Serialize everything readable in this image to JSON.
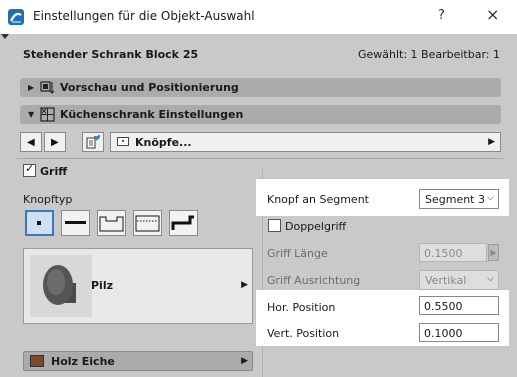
{
  "window": {
    "title": "Einstellungen für die Objekt-Auswahl",
    "help": "?",
    "close": "×"
  },
  "header": {
    "object_name": "Stehender Schrank Block 25",
    "selection_info": "Gewählt: 1 Bearbeitbar: 1"
  },
  "sections": {
    "preview": "Vorschau und Positionierung",
    "kitchen": "Küchenschrank Einstellungen"
  },
  "nav": {
    "prev": "◀",
    "next": "▶",
    "page": "Knöpfe...",
    "page_arrow": "▶"
  },
  "griff": {
    "label": "Griff",
    "checked": true
  },
  "knopftyp": {
    "label": "Knopftyp",
    "selected_index": 0,
    "styles": [
      "dot",
      "bar",
      "notch",
      "dotted-line",
      "hook"
    ],
    "preview_name": "Pilz",
    "preview_arrow": "▶"
  },
  "material": {
    "label": "Holz Eiche",
    "color": "#7a4a2e",
    "arrow": "▶"
  },
  "params": {
    "segment_label": "Knopf an Segment",
    "segment_value": "Segment 3",
    "doppelgriff_label": "Doppelgriff",
    "doppelgriff_checked": false,
    "griff_laenge_label": "Griff Länge",
    "griff_laenge_value": "0.1500",
    "griff_ausrichtung_label": "Griff Ausrichtung",
    "griff_ausrichtung_value": "Vertikal",
    "hor_label": "Hor. Position",
    "hor_value": "0.5500",
    "vert_label": "Vert. Position",
    "vert_value": "0.1000"
  },
  "icons": {
    "chevron_down": "⌵",
    "section_arrow_right": "▶",
    "section_arrow_down": "▼",
    "check": "✓"
  },
  "colors": {
    "highlight": "#ffffff",
    "selected_border": "#3b78c5",
    "section_bar": "#ababab",
    "panel": "#c9c9c9"
  }
}
